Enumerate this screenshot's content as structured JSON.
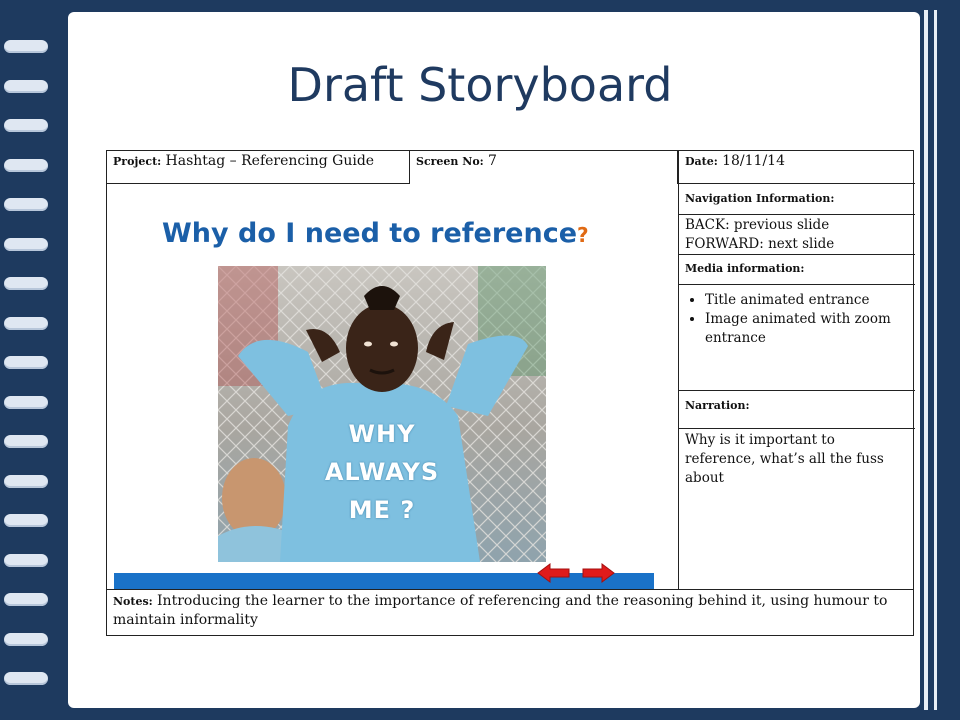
{
  "slide": {
    "title": "Draft Storyboard"
  },
  "storyboard": {
    "project": {
      "label": "Project:",
      "value": "Hashtag – Referencing Guide"
    },
    "screen": {
      "label": "Screen No:",
      "value": "7"
    },
    "date": {
      "label": "Date:",
      "value": "18/11/14"
    },
    "navigation": {
      "label": "Navigation Information:",
      "back": "BACK: previous slide",
      "forward": "FORWARD: next slide"
    },
    "media": {
      "label": "Media information:",
      "items": [
        "Title animated entrance",
        "Image animated with zoom entrance"
      ]
    },
    "narration": {
      "label": "Narration:",
      "text": "Why is it important to reference, what’s all the fuss about"
    },
    "notes": {
      "label": "Notes:",
      "text": "Introducing the learner to the importance of referencing and the reasoning behind it, using humour to maintain informality"
    }
  },
  "mockup": {
    "heading": "Why do I need to reference",
    "heading_mark": "?",
    "shirt_text": [
      "WHY",
      "ALWAYS",
      "ME ?"
    ],
    "image_icon": "footballer-photo",
    "back_icon": "arrow-left-icon",
    "forward_icon": "arrow-right-icon"
  },
  "colors": {
    "frame": "#1e3a5f",
    "title": "#1f3a60",
    "heading": "#1b5fa8",
    "bar": "#1a72c8",
    "arrow": "#e01b1b"
  }
}
